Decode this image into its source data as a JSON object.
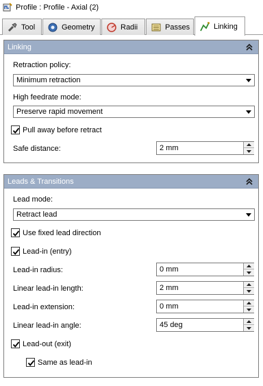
{
  "window": {
    "title": "Profile : Profile - Axial (2)",
    "icon": "profile-icon"
  },
  "tabs": [
    {
      "label": "Tool",
      "icon": "tool-icon"
    },
    {
      "label": "Geometry",
      "icon": "geometry-icon"
    },
    {
      "label": "Radii",
      "icon": "radii-icon"
    },
    {
      "label": "Passes",
      "icon": "passes-icon"
    },
    {
      "label": "Linking",
      "icon": "linking-icon",
      "active": true
    }
  ],
  "linking": {
    "header": "Linking",
    "retraction_policy_label": "Retraction policy:",
    "retraction_policy_value": "Minimum retraction",
    "high_feedrate_label": "High feedrate mode:",
    "high_feedrate_value": "Preserve rapid movement",
    "pull_away_label": "Pull away before retract",
    "pull_away_checked": true,
    "safe_distance_label": "Safe distance:",
    "safe_distance_value": "2 mm"
  },
  "leads": {
    "header": "Leads & Transitions",
    "lead_mode_label": "Lead mode:",
    "lead_mode_value": "Retract lead",
    "fixed_direction_label": "Use fixed lead direction",
    "fixed_direction_checked": true,
    "lead_in_label": "Lead-in (entry)",
    "lead_in_checked": true,
    "lead_in_radius_label": "Lead-in radius:",
    "lead_in_radius_value": "0 mm",
    "linear_lead_in_length_label": "Linear lead-in length:",
    "linear_lead_in_length_value": "2 mm",
    "lead_in_extension_label": "Lead-in extension:",
    "lead_in_extension_value": "0 mm",
    "linear_lead_in_angle_label": "Linear lead-in angle:",
    "linear_lead_in_angle_value": "45 deg",
    "lead_out_label": "Lead-out (exit)",
    "lead_out_checked": true,
    "same_as_lead_in_label": "Same as lead-in",
    "same_as_lead_in_checked": true
  },
  "colors": {
    "panel_header": "#9cadc6",
    "border": "#7f7f7f"
  }
}
